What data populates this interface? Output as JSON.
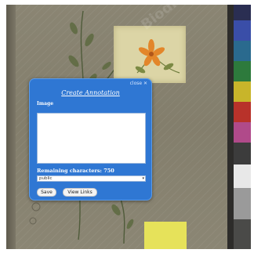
{
  "background": {
    "watermark_text": "Biodiversity Heritage Library",
    "color_chart": [
      "#3a4ea8",
      "#2a6a8e",
      "#2d7a3c",
      "#c8b52a",
      "#b8322a",
      "#b04a8a",
      "#3c3c3c",
      "#9a9a9a",
      "#e8e8e8"
    ],
    "page_color": "#858070",
    "highlight_note_color": "#e6e25a"
  },
  "dialog": {
    "title": "Create Annotation",
    "close_label": "close ✕",
    "image_label": "Image",
    "annotation_text": "",
    "remaining_characters": "Remaining characters: 750",
    "visibility_selected": "public",
    "visibility_options": [
      "public"
    ],
    "save_label": "Save",
    "view_links_label": "View Links",
    "accent_color": "#2f77d3"
  }
}
